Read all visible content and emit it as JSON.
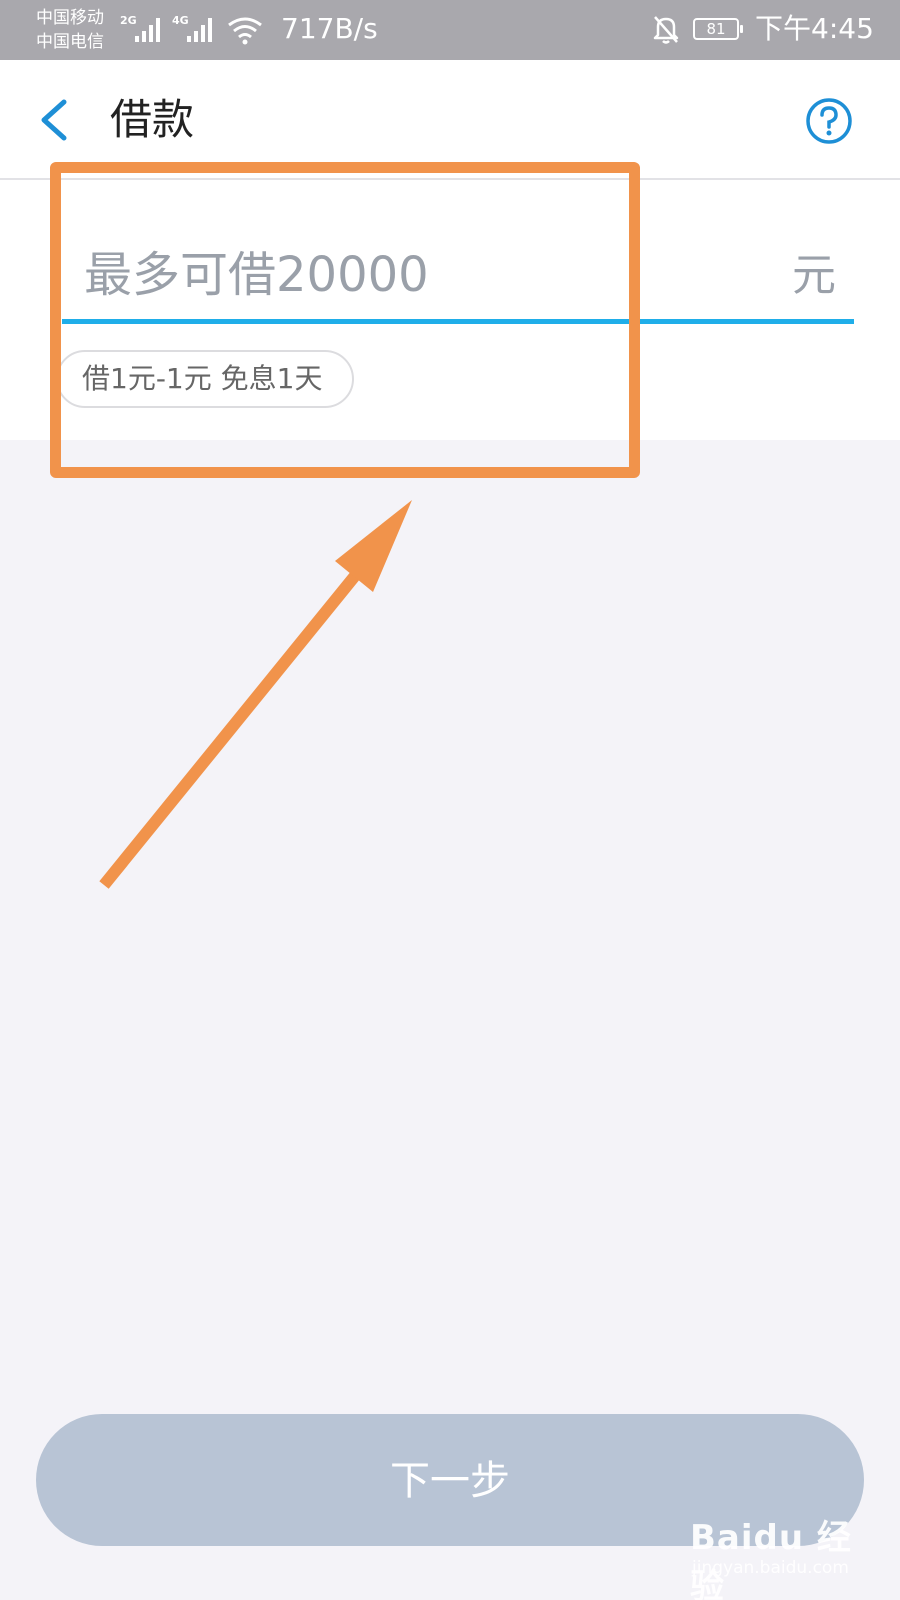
{
  "status_bar": {
    "carrier_1": "中国移动",
    "carrier_2": "中国电信",
    "net_1": "2G",
    "net_2": "4G",
    "speed": "717B/s",
    "battery": "81",
    "time": "下午4:45"
  },
  "header": {
    "title": "借款"
  },
  "loan": {
    "amount_placeholder": "最多可借20000",
    "amount_value": "",
    "unit": "元",
    "promo": "借1元-1元 免息1天"
  },
  "footer": {
    "next_label": "下一步"
  },
  "watermark": {
    "logo_text": "Baidu 经验",
    "sub_text": "jingyan.baidu.com"
  },
  "colors": {
    "accent": "#1faee9",
    "annotation": "#f1934b",
    "button_disabled": "#b8c4d5",
    "status_bar": "#a9a8ad"
  }
}
